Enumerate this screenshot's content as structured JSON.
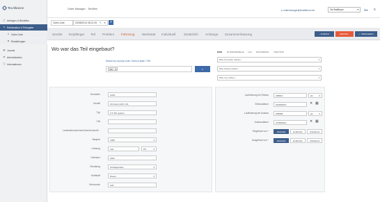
{
  "app": {
    "logo_text": "TecAlliance",
    "title": "Order Manager - TecWeb",
    "user_email": "ordermanager@tecalliance.net",
    "buyer_select": "TecTestBuyer"
  },
  "sidebar": {
    "items": [
      {
        "label": "Anfragen & Bestellen"
      },
      {
        "label": "Reklamation & Rückgabe"
      },
      {
        "label": "Claim Liste"
      },
      {
        "label": "Einstellungen"
      },
      {
        "label": "Journal"
      },
      {
        "label": "Administration"
      },
      {
        "label": "Informationen"
      }
    ]
  },
  "tabs": {
    "claim_list": "Claim Liste",
    "claim_date": "20/08/2014 08:21:25"
  },
  "steps": [
    "Sender",
    "Empfänger",
    "Teil",
    "Problem",
    "Fahrzeug",
    "Werkstatt",
    "Individuell",
    "Zusätzlich",
    "Anhänge",
    "Zusammenfassung"
  ],
  "active_step": "Fahrzeug",
  "buttons": {
    "back": "ZURÜCK",
    "next": "WEITER",
    "save": "SPEICHERN"
  },
  "main": {
    "title": "Wo war das Teil eingebaut?",
    "search_link": "Search by country code / licence plate / VIN",
    "vin_option": "VIN",
    "vehicle_types": [
      "PKW",
      "NUTZFAHRZEUG",
      "LCV",
      "MOTORRAD",
      "TRAKTOR"
    ],
    "manufacturer_placeholder": "Bitte Hersteller wählen...",
    "model_placeholder": "Bitte Modell wählen...",
    "type_placeholder": "Bitte Typ wählen..."
  },
  "form_left": {
    "fields": [
      {
        "label": "Hersteller",
        "value": "AUDI"
      },
      {
        "label": "Modell",
        "value": "A6 Avant (4A5, C4)"
      },
      {
        "label": "Typ",
        "value": "2.5 TDI quattro"
      },
      {
        "label": "VIN",
        "value": ""
      },
      {
        "label": "Landeskennzeichen/Nummernschil...",
        "value": ""
      },
      {
        "label": "Baujahr",
        "value": "1995"
      },
      {
        "label": "Leistung",
        "value": "140"
      },
      {
        "label": "Hubraum",
        "value": "2461"
      },
      {
        "label": "Schaltung",
        "value": "Schaltgetriebe"
      },
      {
        "label": "Kraftstoff",
        "value": "Diesel"
      },
      {
        "label": "Motorcode",
        "value": "AAT"
      }
    ],
    "power_unit": "PS"
  },
  "form_right": {
    "fields": [
      {
        "label": "Laufleistung bei Einbau",
        "value": "205813",
        "unit": "km"
      },
      {
        "label": "Einbaudatum",
        "value": "01/08/2014"
      },
      {
        "label": "Laufleistung bei Ausbau",
        "value": "205998",
        "unit": "km"
      },
      {
        "label": "Ausbaudatum",
        "value": "27/08/2014"
      }
    ],
    "installed_by_label": "Eingebaut von *",
    "removed_by_label": "Ausgebaut von *",
    "choices": [
      "Werkstatt",
      "Endkunde",
      "Unbekannt"
    ]
  }
}
